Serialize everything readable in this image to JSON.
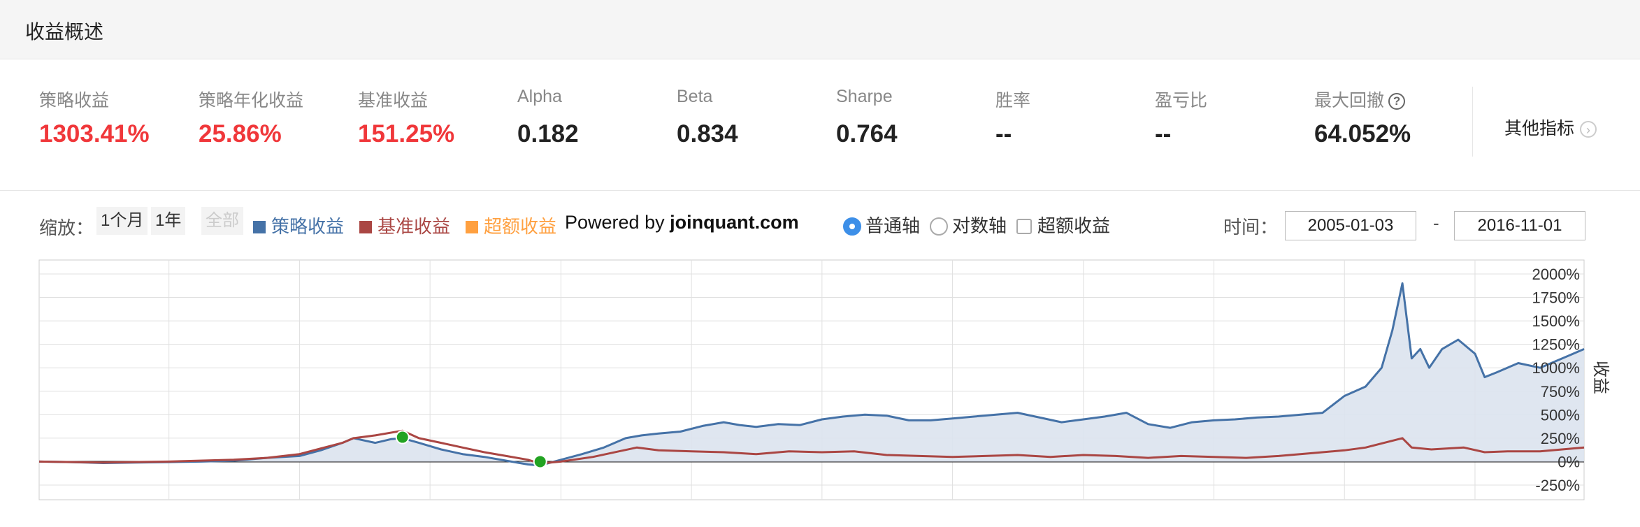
{
  "header": {
    "title": "收益概述"
  },
  "metrics": [
    {
      "label": "策略收益",
      "value": "1303.41%",
      "red": true
    },
    {
      "label": "策略年化收益",
      "value": "25.86%",
      "red": true
    },
    {
      "label": "基准收益",
      "value": "151.25%",
      "red": true
    },
    {
      "label": "Alpha",
      "value": "0.182",
      "red": false
    },
    {
      "label": "Beta",
      "value": "0.834",
      "red": false
    },
    {
      "label": "Sharpe",
      "value": "0.764",
      "red": false
    },
    {
      "label": "胜率",
      "value": "--",
      "red": false
    },
    {
      "label": "盈亏比",
      "value": "--",
      "red": false
    },
    {
      "label": "最大回撤",
      "value": "64.052%",
      "red": false
    }
  ],
  "help_icon": "question-circle-icon",
  "other_metrics": {
    "label": "其他指标",
    "icon": "chevron-right-circle-icon"
  },
  "toolbar": {
    "zoom_label": "缩放：",
    "zoom_1m": "1个月",
    "zoom_1y": "1年",
    "zoom_all": "全部",
    "legend_strategy": "策略收益",
    "legend_benchmark": "基准收益",
    "legend_excess": "超额收益",
    "powered_prefix": "Powered by ",
    "powered_site": "joinquant.com",
    "radio_normal": "普通轴",
    "radio_log": "对数轴",
    "checkbox_excess": "超额收益",
    "time_label": "时间：",
    "date_start": "2005-01-03",
    "date_dash": "-",
    "date_end": "2016-11-01"
  },
  "colors": {
    "strategy": "#4572a7",
    "benchmark": "#aa4643",
    "excess": "#ffa040",
    "area": "#dbe3ee",
    "red_value": "#f0373a",
    "marker": "#22a322"
  },
  "chart_data": {
    "type": "line",
    "x_start": "2005-01-03",
    "x_end": "2016-11-01",
    "ylabel": "收益",
    "ylim": [
      -250,
      2000
    ],
    "yticks": [
      "2000%",
      "1750%",
      "1500%",
      "1250%",
      "1000%",
      "750%",
      "500%",
      "250%",
      "0%",
      "-250%"
    ],
    "yunit": "%",
    "grid": true,
    "series": [
      {
        "name": "策略收益",
        "area": true,
        "x": [
          "2005-01-03",
          "2005-04-01",
          "2005-07-01",
          "2005-10-01",
          "2006-01-01",
          "2006-04-01",
          "2006-07-01",
          "2006-10-01",
          "2007-01-01",
          "2007-03-01",
          "2007-05-01",
          "2007-06-01",
          "2007-08-01",
          "2007-09-15",
          "2007-10-16",
          "2007-12-01",
          "2008-02-01",
          "2008-04-01",
          "2008-06-01",
          "2008-08-01",
          "2008-10-01",
          "2008-11-04",
          "2009-01-01",
          "2009-03-01",
          "2009-05-01",
          "2009-07-01",
          "2009-08-15",
          "2009-10-01",
          "2009-12-01",
          "2010-02-01",
          "2010-04-01",
          "2010-05-15",
          "2010-07-01",
          "2010-09-01",
          "2010-11-01",
          "2011-01-01",
          "2011-03-01",
          "2011-05-01",
          "2011-07-01",
          "2011-09-01",
          "2011-11-01",
          "2012-01-01",
          "2012-03-01",
          "2012-05-01",
          "2012-07-01",
          "2012-09-01",
          "2012-11-01",
          "2013-01-01",
          "2013-03-01",
          "2013-05-01",
          "2013-07-01",
          "2013-09-01",
          "2013-11-01",
          "2014-01-01",
          "2014-03-01",
          "2014-05-01",
          "2014-07-01",
          "2014-09-01",
          "2014-11-01",
          "2015-01-01",
          "2015-03-01",
          "2015-04-15",
          "2015-05-15",
          "2015-06-12",
          "2015-07-08",
          "2015-08-01",
          "2015-08-26",
          "2015-10-01",
          "2015-11-15",
          "2016-01-01",
          "2016-01-28",
          "2016-03-01",
          "2016-05-01",
          "2016-07-01",
          "2016-09-01",
          "2016-11-01"
        ],
        "values": [
          0,
          -5,
          -15,
          -10,
          -5,
          0,
          10,
          40,
          60,
          120,
          200,
          250,
          200,
          240,
          250,
          200,
          130,
          80,
          50,
          10,
          -30,
          -40,
          20,
          80,
          150,
          250,
          280,
          300,
          320,
          380,
          420,
          390,
          370,
          400,
          390,
          450,
          480,
          500,
          490,
          440,
          440,
          460,
          480,
          500,
          520,
          470,
          420,
          450,
          480,
          520,
          400,
          360,
          420,
          440,
          450,
          470,
          480,
          500,
          520,
          700,
          800,
          1000,
          1400,
          1900,
          1100,
          1200,
          1000,
          1200,
          1300,
          1150,
          900,
          950,
          1050,
          1000,
          1100,
          1200
        ]
      },
      {
        "name": "基准收益",
        "area": false,
        "x": [
          "2005-01-03",
          "2005-07-01",
          "2006-01-01",
          "2006-07-01",
          "2006-10-01",
          "2007-01-01",
          "2007-03-01",
          "2007-05-01",
          "2007-06-01",
          "2007-08-01",
          "2007-10-16",
          "2007-12-01",
          "2008-02-01",
          "2008-04-01",
          "2008-06-01",
          "2008-08-01",
          "2008-10-01",
          "2008-11-04",
          "2009-01-01",
          "2009-04-01",
          "2009-08-01",
          "2009-10-01",
          "2010-01-01",
          "2010-04-01",
          "2010-07-01",
          "2010-10-01",
          "2011-01-01",
          "2011-04-01",
          "2011-07-01",
          "2011-10-01",
          "2012-01-01",
          "2012-04-01",
          "2012-07-01",
          "2012-10-01",
          "2013-01-01",
          "2013-04-01",
          "2013-07-01",
          "2013-10-01",
          "2014-01-01",
          "2014-04-01",
          "2014-07-01",
          "2014-10-01",
          "2015-01-01",
          "2015-03-01",
          "2015-06-12",
          "2015-07-08",
          "2015-09-01",
          "2015-12-01",
          "2016-01-28",
          "2016-04-01",
          "2016-07-01",
          "2016-11-01"
        ],
        "values": [
          0,
          -10,
          0,
          20,
          40,
          80,
          140,
          200,
          250,
          280,
          330,
          250,
          200,
          150,
          100,
          60,
          20,
          -20,
          0,
          50,
          150,
          120,
          110,
          100,
          80,
          110,
          100,
          110,
          70,
          60,
          50,
          60,
          70,
          50,
          70,
          60,
          40,
          60,
          50,
          40,
          60,
          90,
          120,
          150,
          250,
          150,
          130,
          150,
          100,
          110,
          110,
          151
        ]
      }
    ],
    "markers": [
      {
        "x": "2007-10-16",
        "y": 260
      },
      {
        "x": "2008-11-04",
        "y": 0
      }
    ]
  }
}
